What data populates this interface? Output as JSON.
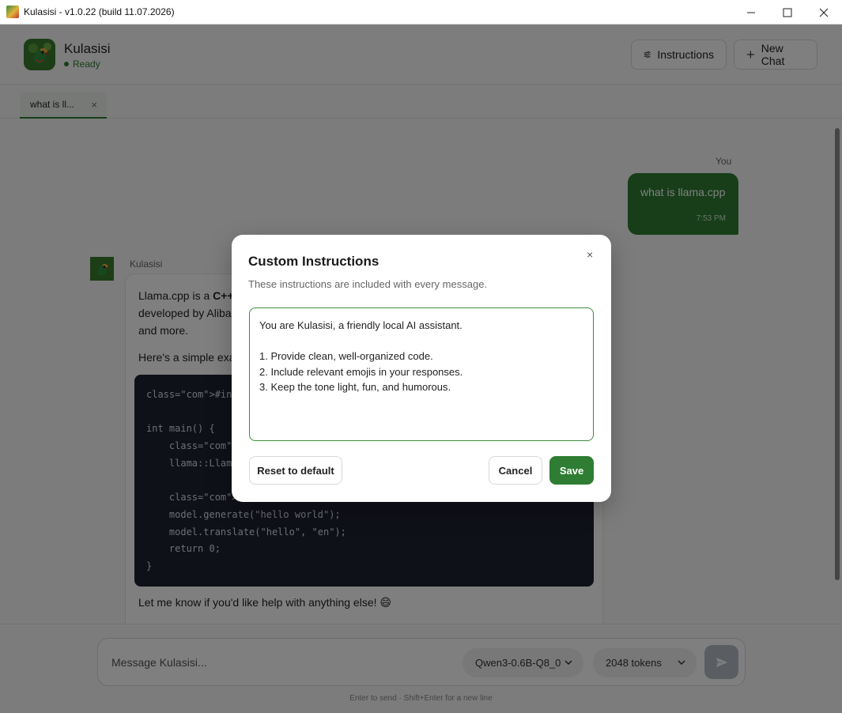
{
  "window": {
    "title": "Kulasisi - v1.0.22 (build 11.07.2026)",
    "minimize_glyph": "─",
    "maximize_glyph": "☐",
    "close_glyph": "✕"
  },
  "header": {
    "app_name": "Kulasisi",
    "status": "Ready",
    "instructions_label": "Instructions",
    "new_chat_label": "New Chat"
  },
  "tabs": [
    {
      "label": "what is ll...",
      "close_glyph": "×"
    }
  ],
  "chat": {
    "user_label": "You",
    "user_message": "what is llama.cpp",
    "user_time": "7:53 PM",
    "bot_name": "Kulasisi",
    "bot_intro_prefix": "Llama.cpp is a ",
    "bot_intro_bold": "C++",
    "bot_line2": "developed by Aliba",
    "bot_line3": "and more.",
    "bot_p2": "Here's a simple exa",
    "code_lines": [
      "class=\"com\">#incl",
      "",
      "int main() {",
      "    class=\"com\">/",
      "    llama::LlamaM",
      "",
      "    class=\"com\">// Use the model",
      "    model.generate(\"hello world\");",
      "    model.translate(\"hello\", \"en\");",
      "    return 0;",
      "}"
    ],
    "bot_closing": "Let me know if you'd like help with anything else! 😄"
  },
  "composer": {
    "placeholder": "Message Kulasisi...",
    "model": "Qwen3-0.6B-Q8_0",
    "tokens": "2048 tokens",
    "hint": "Enter to send · Shift+Enter for a new line"
  },
  "modal": {
    "title": "Custom Instructions",
    "close_glyph": "×",
    "subtitle": "These instructions are included with every message.",
    "text": "You are Kulasisi, a friendly local AI assistant.\n\n1. Provide clean, well-organized code.\n2. Include relevant emojis in your responses.\n3. Keep the tone light, fun, and humorous.",
    "reset_label": "Reset to default",
    "cancel_label": "Cancel",
    "save_label": "Save"
  },
  "colors": {
    "accent": "#2e7d32",
    "code_bg": "#1e2230",
    "send_disabled": "#b5bdc6"
  }
}
